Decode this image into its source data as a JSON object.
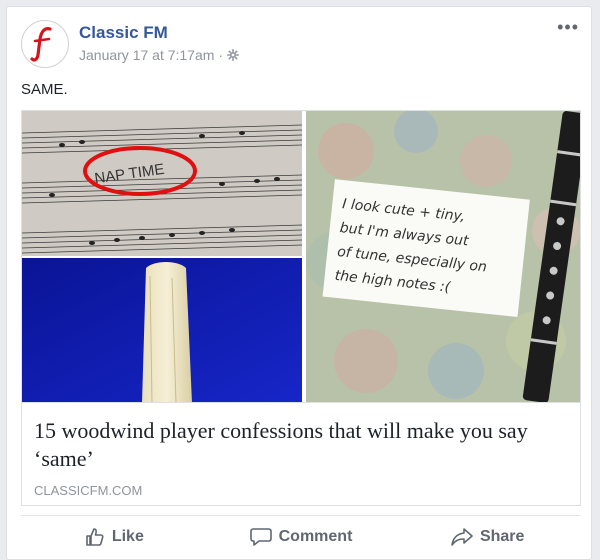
{
  "post": {
    "page_name": "Classic FM",
    "timestamp": "January 17 at 7:17am",
    "separator": "·",
    "privacy_icon": "gear-icon",
    "more_icon": "more-options-icon",
    "more_label": "•••",
    "message": "SAME."
  },
  "media": {
    "sheet_music_text": "NAP TIME",
    "note_text_lines": [
      "I look cute + tiny,",
      "but I'm always out",
      "of tune, especially on",
      "the high notes :("
    ]
  },
  "link": {
    "title": "15 woodwind player confessions that will make you say ‘same’",
    "domain": "CLASSICFM.COM"
  },
  "actions": [
    {
      "label": "Like",
      "icon": "thumbs-up-icon"
    },
    {
      "label": "Comment",
      "icon": "comment-icon"
    },
    {
      "label": "Share",
      "icon": "share-icon"
    }
  ],
  "colors": {
    "brand_red": "#d6141e",
    "link_blue": "#365899",
    "meta_gray": "#90949c",
    "reed_blue_bg": "#0f1bb0"
  }
}
